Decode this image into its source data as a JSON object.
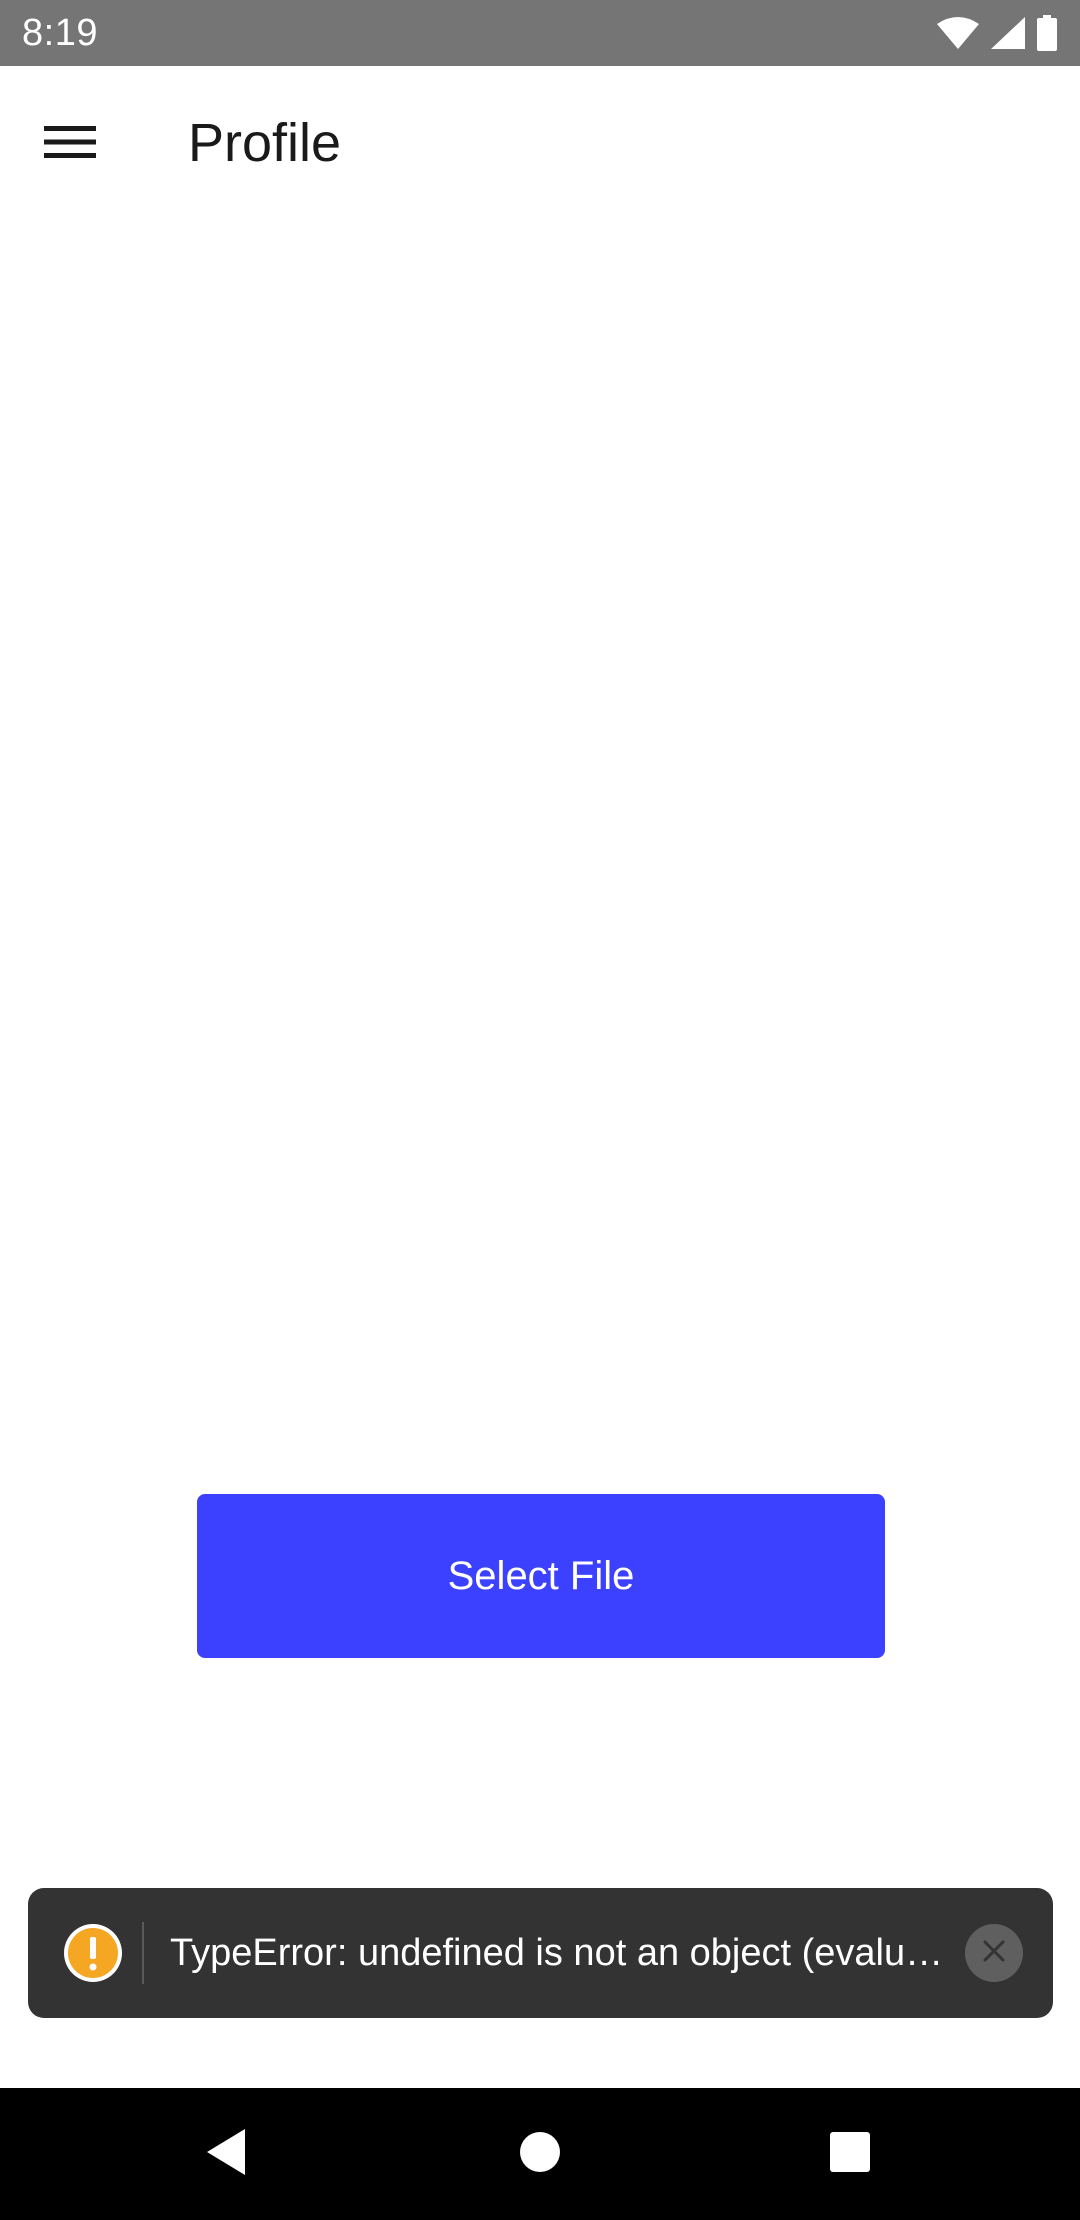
{
  "status_bar": {
    "time": "8:19",
    "icons": [
      "wifi-icon",
      "signal-icon",
      "battery-icon"
    ]
  },
  "app_bar": {
    "title": "Profile",
    "menu_icon": "hamburger-menu-icon"
  },
  "main": {
    "select_file_label": "Select File"
  },
  "error_toast": {
    "icon": "warning-icon",
    "message": "TypeError: undefined is not an object (evalu…",
    "close_icon": "close-icon"
  },
  "nav_bar": {
    "buttons": [
      "back-icon",
      "home-icon",
      "recents-icon"
    ]
  },
  "colors": {
    "status_bar": "#757575",
    "accent": "#3b41ff",
    "toast_background": "#333333",
    "warning": "#f5a623",
    "nav_bar": "#000000"
  }
}
